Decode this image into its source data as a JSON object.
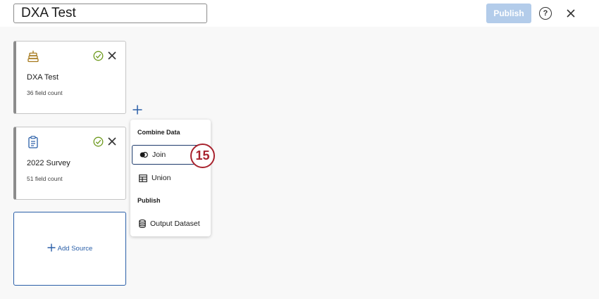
{
  "header": {
    "title_value": "DXA Test",
    "publish_label": "Publish",
    "help_glyph": "?"
  },
  "sources": [
    {
      "name": "DXA Test",
      "count": "36 field count",
      "icon": "database-stack-icon",
      "status": "check-circle-icon"
    },
    {
      "name": "2022 Survey",
      "count": "51 field count",
      "icon": "survey-clipboard-icon",
      "status": "check-circle-icon"
    }
  ],
  "add_source": {
    "label": "Add Source"
  },
  "menu": {
    "combine_heading": "Combine Data",
    "join_label": "Join",
    "union_label": "Union",
    "publish_heading": "Publish",
    "output_label": "Output Dataset"
  },
  "step_badge": "15",
  "colors": {
    "accent": "#2a5fa8",
    "publish_disabled": "#b3ccea",
    "success": "#6e9a1e",
    "source_icon_gold": "#a5781b",
    "step_badge": "#a8232e"
  }
}
